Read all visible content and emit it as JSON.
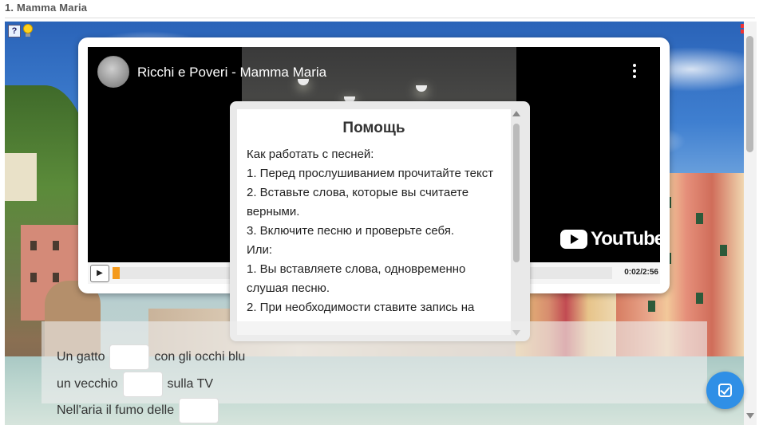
{
  "page": {
    "title": "1. Mamma Maria"
  },
  "video": {
    "title": "Ricchi e Poveri - Mamma Maria",
    "brand": "YouTube",
    "play_symbol": "▶",
    "time": "0:02/2:56",
    "progress_fraction": 0.013
  },
  "help": {
    "title": "Помощь",
    "lines": [
      "Как работать с песней:",
      "1. Перед прослушиванием прочитайте текст",
      "2. Вставьте слова, которые вы считаете верными.",
      "3. Включите песню и проверьте себя.",
      "Или:",
      "1. Вы вставляете слова, одновременно слушая песню.",
      "2. При необходимости ставите запись на"
    ]
  },
  "lyrics": {
    "line1": {
      "before": "Un gatto",
      "after": "con gli occhi blu"
    },
    "line2": {
      "before": "un vecchio",
      "after": "sulla TV"
    },
    "line3": {
      "before": "Nell'aria il fumo delle",
      "after": ""
    }
  },
  "icons": {
    "help": "help-question-icon",
    "hint": "lightbulb-icon",
    "fullscreen": "fullscreen-icon",
    "check": "check-answers-icon"
  },
  "colors": {
    "progress": "#f49a1c",
    "fab": "#2f8fe6"
  }
}
